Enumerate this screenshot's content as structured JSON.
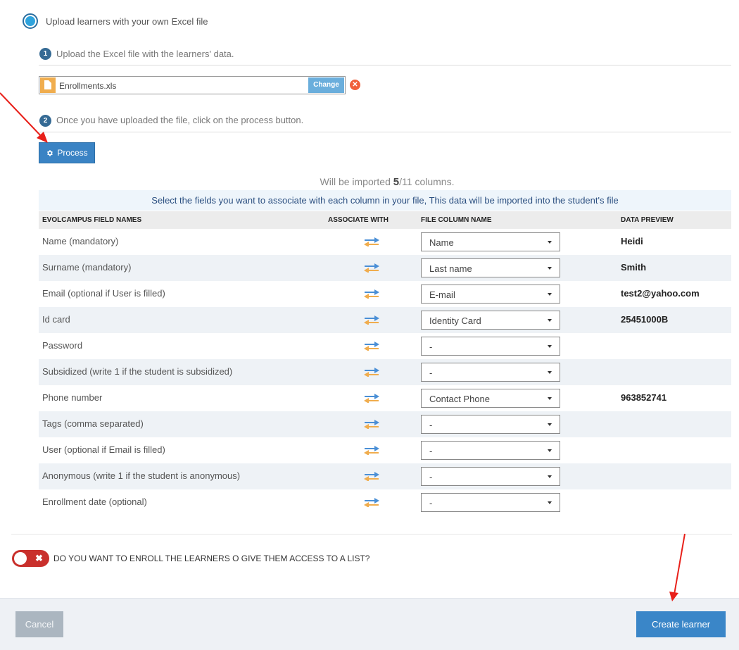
{
  "upload_option": {
    "label": "Upload learners with your own Excel file"
  },
  "steps": [
    {
      "number": "1",
      "text": "Upload the Excel file with the learners' data."
    },
    {
      "number": "2",
      "text": "Once you have uploaded the file, click on the process button."
    }
  ],
  "file": {
    "name": "Enrollments.xls",
    "change_label": "Change",
    "remove_symbol": "✕",
    "icon": "file-icon"
  },
  "process_button": {
    "label": "Process",
    "icon": "gear-icon"
  },
  "import_info": {
    "prefix": "Will be imported ",
    "count": "5",
    "suffix": "/11 columns."
  },
  "banner": "Select the fields you want to associate with each column in your file, This data will be imported into the student's file",
  "table": {
    "headers": [
      "EVOLCAMPUS FIELD NAMES",
      "ASSOCIATE WITH",
      "FILE COLUMN NAME",
      "DATA PREVIEW"
    ],
    "rows": [
      {
        "field": "Name (mandatory)",
        "column": "Name",
        "preview": "Heidi"
      },
      {
        "field": "Surname (mandatory)",
        "column": "Last name",
        "preview": "Smith"
      },
      {
        "field": "Email (optional if User is filled)",
        "column": "E-mail",
        "preview": "test2@yahoo.com"
      },
      {
        "field": "Id card",
        "column": "Identity Card",
        "preview": "25451000B"
      },
      {
        "field": "Password",
        "column": "-",
        "preview": ""
      },
      {
        "field": "Subsidized (write 1 if the student is subsidized)",
        "column": "-",
        "preview": ""
      },
      {
        "field": "Phone number",
        "column": "Contact Phone",
        "preview": "963852741"
      },
      {
        "field": "Tags (comma separated)",
        "column": "-",
        "preview": ""
      },
      {
        "field": "User (optional if Email is filled)",
        "column": "-",
        "preview": ""
      },
      {
        "field": "Anonymous (write 1 if the student is anonymous)",
        "column": "-",
        "preview": ""
      },
      {
        "field": "Enrollment date (optional)",
        "column": "-",
        "preview": ""
      }
    ]
  },
  "toggle": {
    "label": "DO YOU WANT TO ENROLL THE LEARNERS O GIVE THEM ACCESS TO A LIST?",
    "state": "off",
    "symbol": "✖"
  },
  "footer": {
    "cancel_label": "Cancel",
    "create_label": "Create learner"
  },
  "colors": {
    "primary": "#3a86c8",
    "step_badge": "#356a94",
    "file_icon": "#f0ad4e",
    "remove": "#f0613c",
    "toggle_off": "#c9302c",
    "annotation_arrow": "#e8201a"
  }
}
